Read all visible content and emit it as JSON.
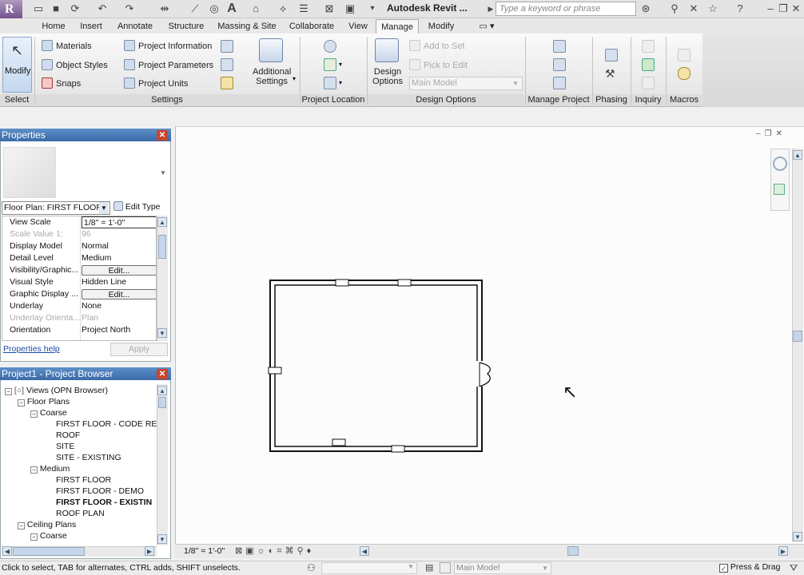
{
  "app": {
    "title": "Autodesk Revit ...",
    "search_placeholder": "Type a keyword or phrase"
  },
  "tabs": [
    {
      "label": "Home"
    },
    {
      "label": "Insert"
    },
    {
      "label": "Annotate"
    },
    {
      "label": "Structure"
    },
    {
      "label": "Massing & Site"
    },
    {
      "label": "Collaborate"
    },
    {
      "label": "View"
    },
    {
      "label": "Manage"
    },
    {
      "label": "Modify"
    }
  ],
  "ribbon": {
    "select": {
      "modify": "Modify",
      "panel": "Select"
    },
    "settings": {
      "materials": "Materials",
      "object_styles": "Object Styles",
      "snaps": "Snaps",
      "project_information": "Project Information",
      "project_parameters": "Project Parameters",
      "project_units": "Project Units",
      "additional_settings_1": "Additional",
      "additional_settings_2": "Settings",
      "panel": "Settings"
    },
    "project_location": {
      "panel": "Project Location"
    },
    "design_options": {
      "btn_1": "Design",
      "btn_2": "Options",
      "add_to_set": "Add to Set",
      "pick_to_edit": "Pick to Edit",
      "main_model": "Main Model",
      "panel": "Design Options"
    },
    "manage_project": {
      "panel": "Manage Project"
    },
    "phasing": {
      "panel": "Phasing"
    },
    "inquiry": {
      "panel": "Inquiry"
    },
    "macros": {
      "panel": "Macros"
    }
  },
  "properties": {
    "title": "Properties",
    "type_selector": "Floor Plan: FIRST FLOOR",
    "edit_type": "Edit Type",
    "rows": [
      {
        "key": "View Scale",
        "value": "1/8\" = 1'-0\""
      },
      {
        "key": "Scale Value    1:",
        "value": "96"
      },
      {
        "key": "Display Model",
        "value": "Normal"
      },
      {
        "key": "Detail Level",
        "value": "Medium"
      },
      {
        "key": "Visibility/Graphic...",
        "value": "Edit..."
      },
      {
        "key": "Visual Style",
        "value": "Hidden Line"
      },
      {
        "key": "Graphic Display ...",
        "value": "Edit..."
      },
      {
        "key": "Underlay",
        "value": "None"
      },
      {
        "key": "Underlay Orienta...",
        "value": "Plan"
      },
      {
        "key": "Orientation",
        "value": "Project North"
      }
    ],
    "help": "Properties help",
    "apply": "Apply"
  },
  "browser": {
    "title": "Project1 - Project Browser",
    "items": [
      {
        "label": "Views (OPN Browser)"
      },
      {
        "label": "Floor Plans"
      },
      {
        "label": "Coarse"
      },
      {
        "label": "FIRST FLOOR - CODE REVI"
      },
      {
        "label": "ROOF"
      },
      {
        "label": "SITE"
      },
      {
        "label": "SITE - EXISTING"
      },
      {
        "label": "Medium"
      },
      {
        "label": "FIRST FLOOR"
      },
      {
        "label": "FIRST FLOOR - DEMO"
      },
      {
        "label": "FIRST FLOOR - EXISTIN"
      },
      {
        "label": "ROOF PLAN"
      },
      {
        "label": "Ceiling Plans"
      },
      {
        "label": "Coarse"
      }
    ]
  },
  "viewbar": {
    "scale": "1/8\" = 1'-0\""
  },
  "status": {
    "hint": "Click to select, TAB for alternates, CTRL adds, SHIFT unselects.",
    "model": "Main Model",
    "press_drag": "Press & Drag"
  }
}
